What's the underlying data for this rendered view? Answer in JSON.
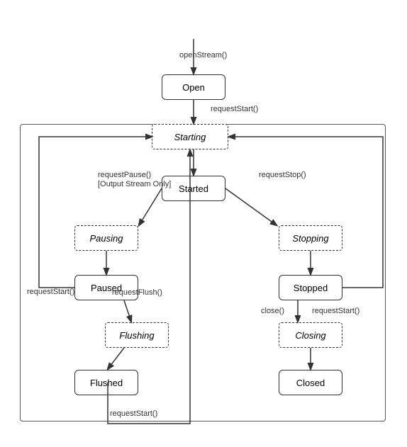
{
  "states": {
    "open": {
      "label": "Open"
    },
    "starting": {
      "label": "Starting"
    },
    "started": {
      "label": "Started"
    },
    "pausing": {
      "label": "Pausing"
    },
    "paused": {
      "label": "Paused"
    },
    "flushing": {
      "label": "Flushing"
    },
    "flushed": {
      "label": "Flushed"
    },
    "stopping": {
      "label": "Stopping"
    },
    "stopped": {
      "label": "Stopped"
    },
    "closing": {
      "label": "Closing"
    },
    "closed": {
      "label": "Closed"
    }
  },
  "transitions": {
    "openStream": "openStream()",
    "requestStart1": "requestStart()",
    "requestPause": "requestPause()",
    "outputStreamOnly": "[Output Stream Only]",
    "requestStop": "requestStop()",
    "requestStart2": "requestStart()",
    "requestFlush": "requestFlush()",
    "close": "close()",
    "requestStart3": "requestStart()",
    "requestStart4": "requestStart()"
  }
}
